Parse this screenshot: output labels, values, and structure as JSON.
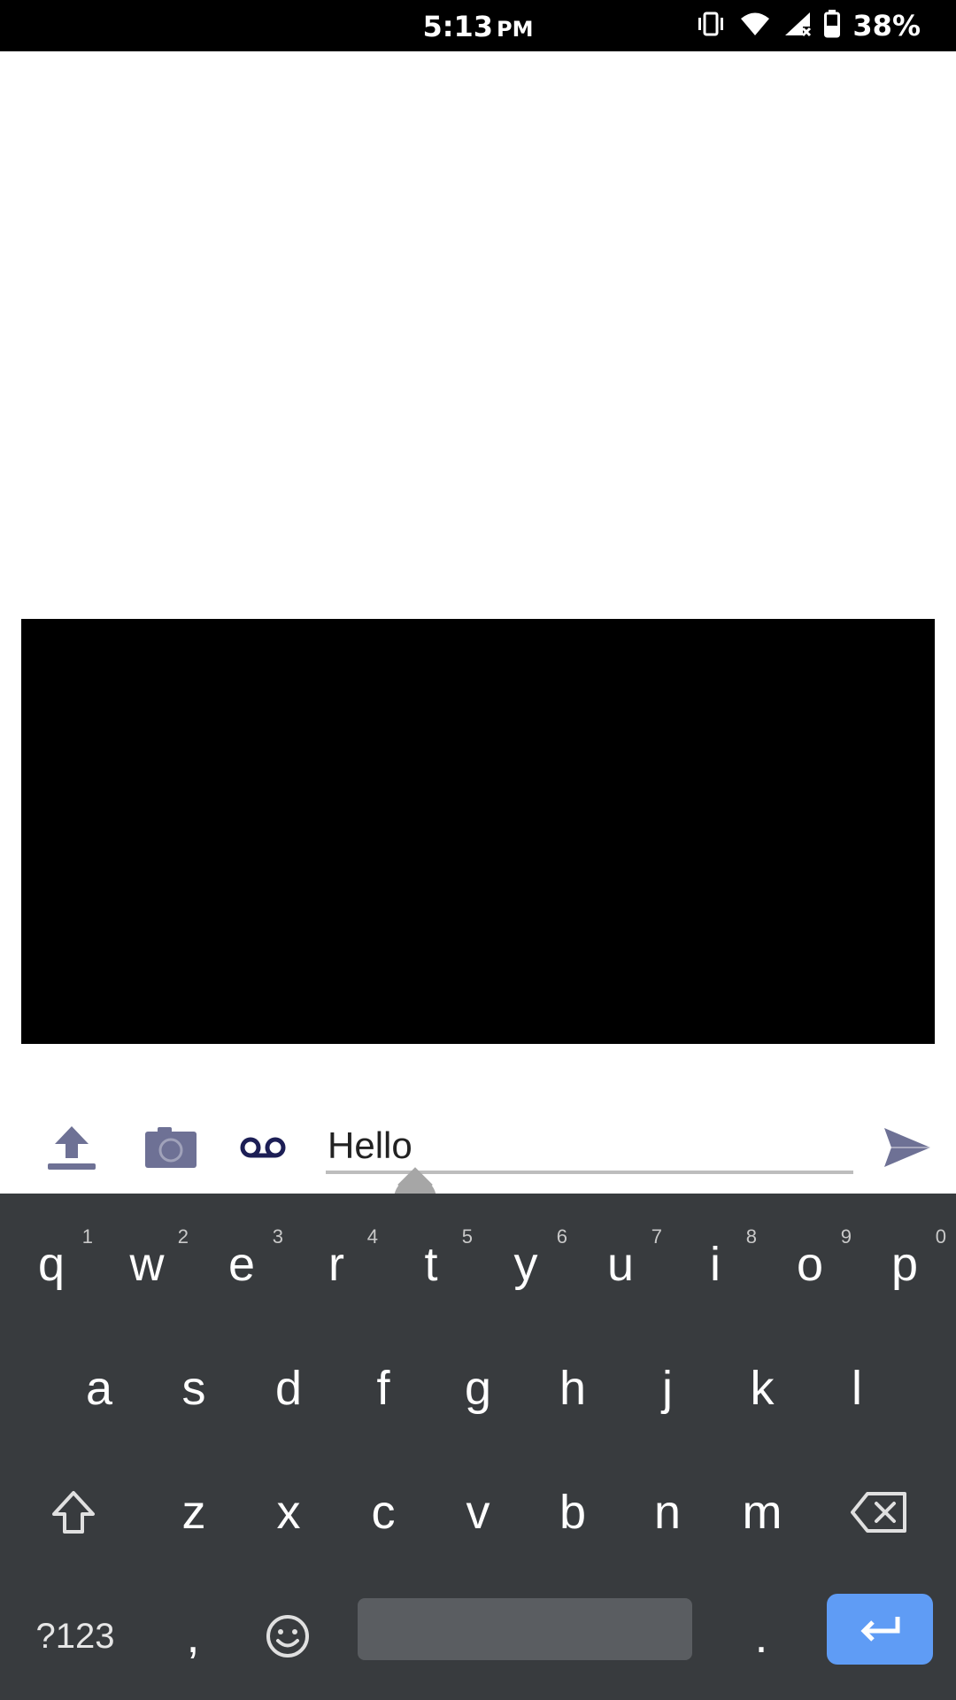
{
  "status_bar": {
    "time": "5:13",
    "ampm": "PM",
    "battery_percent": "38%",
    "icons": [
      "vibrate-icon",
      "wifi-icon",
      "cell-signal-no-service-icon",
      "battery-icon"
    ]
  },
  "compose": {
    "input_value": "Hello",
    "icons": [
      "upload-icon",
      "camera-icon",
      "voicemail-icon",
      "send-icon"
    ],
    "accent_color": "#6e7195"
  },
  "keyboard": {
    "row1": [
      {
        "key": "q",
        "hint": "1"
      },
      {
        "key": "w",
        "hint": "2"
      },
      {
        "key": "e",
        "hint": "3"
      },
      {
        "key": "r",
        "hint": "4"
      },
      {
        "key": "t",
        "hint": "5"
      },
      {
        "key": "y",
        "hint": "6"
      },
      {
        "key": "u",
        "hint": "7"
      },
      {
        "key": "i",
        "hint": "8"
      },
      {
        "key": "o",
        "hint": "9"
      },
      {
        "key": "p",
        "hint": "0"
      }
    ],
    "row2": [
      "a",
      "s",
      "d",
      "f",
      "g",
      "h",
      "j",
      "k",
      "l"
    ],
    "row3": [
      "z",
      "x",
      "c",
      "v",
      "b",
      "n",
      "m"
    ],
    "symbols_label": "?123",
    "comma": ",",
    "period": ".",
    "enter_color": "#5f9cf5"
  }
}
